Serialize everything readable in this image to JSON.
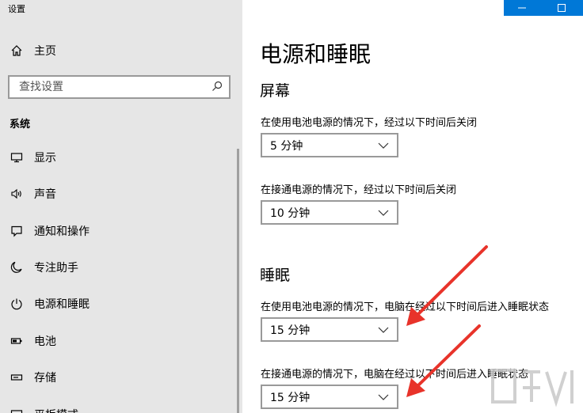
{
  "app_title": "设置",
  "sidebar": {
    "home_label": "主页",
    "search_placeholder": "查找设置",
    "section_title": "系统",
    "items": [
      {
        "label": "显示",
        "icon": "monitor-icon"
      },
      {
        "label": "声音",
        "icon": "speaker-icon"
      },
      {
        "label": "通知和操作",
        "icon": "notification-icon"
      },
      {
        "label": "专注助手",
        "icon": "moon-icon"
      },
      {
        "label": "电源和睡眠",
        "icon": "power-icon"
      },
      {
        "label": "电池",
        "icon": "battery-icon"
      },
      {
        "label": "存储",
        "icon": "storage-icon"
      },
      {
        "label": "平板模式",
        "icon": "tablet-icon"
      }
    ]
  },
  "window_controls": {
    "minimize": "—",
    "maximize": "☐"
  },
  "main": {
    "title": "电源和睡眠",
    "screen": {
      "title": "屏幕",
      "battery_label": "在使用电池电源的情况下，经过以下时间后关闭",
      "battery_value": "5 分钟",
      "plugged_label": "在接通电源的情况下，经过以下时间后关闭",
      "plugged_value": "10 分钟"
    },
    "sleep": {
      "title": "睡眠",
      "battery_label": "在使用电池电源的情况下，电脑在经过以下时间后进入睡眠状态",
      "battery_value": "15 分钟",
      "plugged_label": "在接通电源的情况下，电脑在经过以下时间后进入睡眠状态",
      "plugged_value": "15 分钟"
    }
  },
  "colors": {
    "accent": "#0078d7",
    "annotation_arrow": "#e8332a",
    "sidebar_bg": "#e6e6e6"
  }
}
